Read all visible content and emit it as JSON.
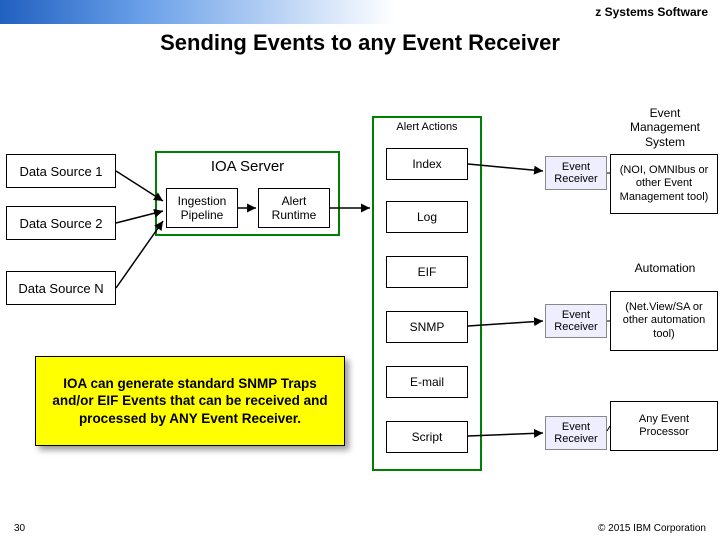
{
  "header": {
    "product": "z Systems Software"
  },
  "title": "Sending Events to any Event Receiver",
  "sources": {
    "s1": "Data Source 1",
    "s2": "Data Source 2",
    "sn": "Data Source N"
  },
  "ioa": {
    "title": "IOA Server",
    "ingestion": "Ingestion\nPipeline",
    "runtime": "Alert\nRuntime"
  },
  "alerts": {
    "title": "Alert Actions",
    "index": "Index",
    "log": "Log",
    "eif": "EIF",
    "snmp": "SNMP",
    "email": "E-mail",
    "script": "Script"
  },
  "receivers": {
    "label": "Event\nReceiver"
  },
  "ems": {
    "heading": "Event\nManagement\nSystem",
    "noi": "(NOI, OMNIbus or other Event Management tool)",
    "automation_label": "Automation",
    "netview": "(Net.View/SA or other automation tool)",
    "anyproc": "Any Event Processor"
  },
  "callout": "IOA can generate standard SNMP Traps and/or EIF Events that can be received and processed by ANY Event Receiver.",
  "footer": {
    "page": "30",
    "copyright": "© 2015 IBM Corporation"
  }
}
